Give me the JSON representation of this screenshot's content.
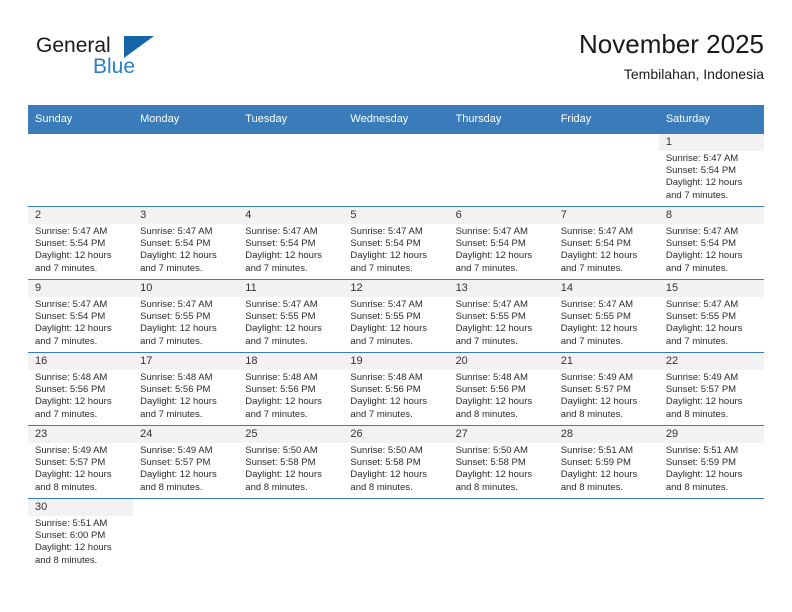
{
  "brand": {
    "name_top": "General",
    "name_bottom": "Blue",
    "accent_color": "#2980c4",
    "triangle_color": "#1665a8"
  },
  "header": {
    "title": "November 2025",
    "subtitle": "Tembilahan, Indonesia"
  },
  "theme": {
    "header_bg": "#3a7cb9",
    "daynum_bg": "#f2f2f2",
    "grid_line": "#3a7cb9",
    "text": "#2b2b2b"
  },
  "weekday_headers": [
    "Sunday",
    "Monday",
    "Tuesday",
    "Wednesday",
    "Thursday",
    "Friday",
    "Saturday"
  ],
  "labels": {
    "sunrise_prefix": "Sunrise:",
    "sunset_prefix": "Sunset:",
    "daylight_prefix": "Daylight:"
  },
  "weeks": [
    [
      {
        "day": "",
        "blank": true,
        "sunrise": "",
        "sunset": "",
        "daylight": ""
      },
      {
        "day": "",
        "blank": true,
        "sunrise": "",
        "sunset": "",
        "daylight": ""
      },
      {
        "day": "",
        "blank": true,
        "sunrise": "",
        "sunset": "",
        "daylight": ""
      },
      {
        "day": "",
        "blank": true,
        "sunrise": "",
        "sunset": "",
        "daylight": ""
      },
      {
        "day": "",
        "blank": true,
        "sunrise": "",
        "sunset": "",
        "daylight": ""
      },
      {
        "day": "",
        "blank": true,
        "sunrise": "",
        "sunset": "",
        "daylight": ""
      },
      {
        "day": "1",
        "sunrise": "Sunrise: 5:47 AM",
        "sunset": "Sunset: 5:54 PM",
        "daylight": "Daylight: 12 hours and 7 minutes."
      }
    ],
    [
      {
        "day": "2",
        "sunrise": "Sunrise: 5:47 AM",
        "sunset": "Sunset: 5:54 PM",
        "daylight": "Daylight: 12 hours and 7 minutes."
      },
      {
        "day": "3",
        "sunrise": "Sunrise: 5:47 AM",
        "sunset": "Sunset: 5:54 PM",
        "daylight": "Daylight: 12 hours and 7 minutes."
      },
      {
        "day": "4",
        "sunrise": "Sunrise: 5:47 AM",
        "sunset": "Sunset: 5:54 PM",
        "daylight": "Daylight: 12 hours and 7 minutes."
      },
      {
        "day": "5",
        "sunrise": "Sunrise: 5:47 AM",
        "sunset": "Sunset: 5:54 PM",
        "daylight": "Daylight: 12 hours and 7 minutes."
      },
      {
        "day": "6",
        "sunrise": "Sunrise: 5:47 AM",
        "sunset": "Sunset: 5:54 PM",
        "daylight": "Daylight: 12 hours and 7 minutes."
      },
      {
        "day": "7",
        "sunrise": "Sunrise: 5:47 AM",
        "sunset": "Sunset: 5:54 PM",
        "daylight": "Daylight: 12 hours and 7 minutes."
      },
      {
        "day": "8",
        "sunrise": "Sunrise: 5:47 AM",
        "sunset": "Sunset: 5:54 PM",
        "daylight": "Daylight: 12 hours and 7 minutes."
      }
    ],
    [
      {
        "day": "9",
        "sunrise": "Sunrise: 5:47 AM",
        "sunset": "Sunset: 5:54 PM",
        "daylight": "Daylight: 12 hours and 7 minutes."
      },
      {
        "day": "10",
        "sunrise": "Sunrise: 5:47 AM",
        "sunset": "Sunset: 5:55 PM",
        "daylight": "Daylight: 12 hours and 7 minutes."
      },
      {
        "day": "11",
        "sunrise": "Sunrise: 5:47 AM",
        "sunset": "Sunset: 5:55 PM",
        "daylight": "Daylight: 12 hours and 7 minutes."
      },
      {
        "day": "12",
        "sunrise": "Sunrise: 5:47 AM",
        "sunset": "Sunset: 5:55 PM",
        "daylight": "Daylight: 12 hours and 7 minutes."
      },
      {
        "day": "13",
        "sunrise": "Sunrise: 5:47 AM",
        "sunset": "Sunset: 5:55 PM",
        "daylight": "Daylight: 12 hours and 7 minutes."
      },
      {
        "day": "14",
        "sunrise": "Sunrise: 5:47 AM",
        "sunset": "Sunset: 5:55 PM",
        "daylight": "Daylight: 12 hours and 7 minutes."
      },
      {
        "day": "15",
        "sunrise": "Sunrise: 5:47 AM",
        "sunset": "Sunset: 5:55 PM",
        "daylight": "Daylight: 12 hours and 7 minutes."
      }
    ],
    [
      {
        "day": "16",
        "sunrise": "Sunrise: 5:48 AM",
        "sunset": "Sunset: 5:56 PM",
        "daylight": "Daylight: 12 hours and 7 minutes."
      },
      {
        "day": "17",
        "sunrise": "Sunrise: 5:48 AM",
        "sunset": "Sunset: 5:56 PM",
        "daylight": "Daylight: 12 hours and 7 minutes."
      },
      {
        "day": "18",
        "sunrise": "Sunrise: 5:48 AM",
        "sunset": "Sunset: 5:56 PM",
        "daylight": "Daylight: 12 hours and 7 minutes."
      },
      {
        "day": "19",
        "sunrise": "Sunrise: 5:48 AM",
        "sunset": "Sunset: 5:56 PM",
        "daylight": "Daylight: 12 hours and 7 minutes."
      },
      {
        "day": "20",
        "sunrise": "Sunrise: 5:48 AM",
        "sunset": "Sunset: 5:56 PM",
        "daylight": "Daylight: 12 hours and 8 minutes."
      },
      {
        "day": "21",
        "sunrise": "Sunrise: 5:49 AM",
        "sunset": "Sunset: 5:57 PM",
        "daylight": "Daylight: 12 hours and 8 minutes."
      },
      {
        "day": "22",
        "sunrise": "Sunrise: 5:49 AM",
        "sunset": "Sunset: 5:57 PM",
        "daylight": "Daylight: 12 hours and 8 minutes."
      }
    ],
    [
      {
        "day": "23",
        "sunrise": "Sunrise: 5:49 AM",
        "sunset": "Sunset: 5:57 PM",
        "daylight": "Daylight: 12 hours and 8 minutes."
      },
      {
        "day": "24",
        "sunrise": "Sunrise: 5:49 AM",
        "sunset": "Sunset: 5:57 PM",
        "daylight": "Daylight: 12 hours and 8 minutes."
      },
      {
        "day": "25",
        "sunrise": "Sunrise: 5:50 AM",
        "sunset": "Sunset: 5:58 PM",
        "daylight": "Daylight: 12 hours and 8 minutes."
      },
      {
        "day": "26",
        "sunrise": "Sunrise: 5:50 AM",
        "sunset": "Sunset: 5:58 PM",
        "daylight": "Daylight: 12 hours and 8 minutes."
      },
      {
        "day": "27",
        "sunrise": "Sunrise: 5:50 AM",
        "sunset": "Sunset: 5:58 PM",
        "daylight": "Daylight: 12 hours and 8 minutes."
      },
      {
        "day": "28",
        "sunrise": "Sunrise: 5:51 AM",
        "sunset": "Sunset: 5:59 PM",
        "daylight": "Daylight: 12 hours and 8 minutes."
      },
      {
        "day": "29",
        "sunrise": "Sunrise: 5:51 AM",
        "sunset": "Sunset: 5:59 PM",
        "daylight": "Daylight: 12 hours and 8 minutes."
      }
    ],
    [
      {
        "day": "30",
        "sunrise": "Sunrise: 5:51 AM",
        "sunset": "Sunset: 6:00 PM",
        "daylight": "Daylight: 12 hours and 8 minutes."
      },
      {
        "day": "",
        "blank": true,
        "sunrise": "",
        "sunset": "",
        "daylight": ""
      },
      {
        "day": "",
        "blank": true,
        "sunrise": "",
        "sunset": "",
        "daylight": ""
      },
      {
        "day": "",
        "blank": true,
        "sunrise": "",
        "sunset": "",
        "daylight": ""
      },
      {
        "day": "",
        "blank": true,
        "sunrise": "",
        "sunset": "",
        "daylight": ""
      },
      {
        "day": "",
        "blank": true,
        "sunrise": "",
        "sunset": "",
        "daylight": ""
      },
      {
        "day": "",
        "blank": true,
        "sunrise": "",
        "sunset": "",
        "daylight": ""
      }
    ]
  ]
}
